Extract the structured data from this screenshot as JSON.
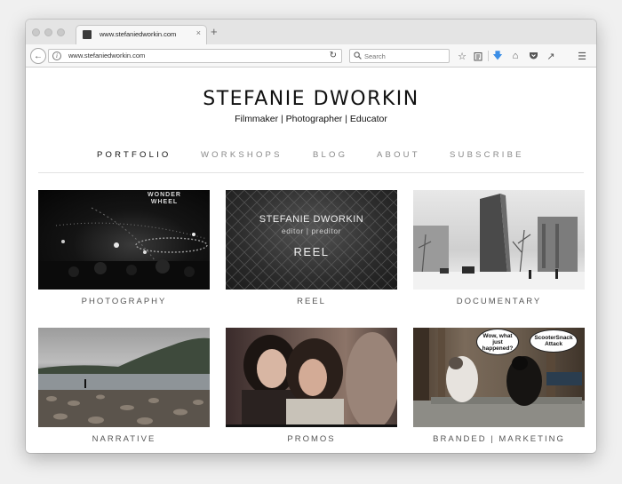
{
  "browser": {
    "tab_title": "www.stefaniedworkin.com",
    "tab_close": "×",
    "new_tab": "+",
    "url": "www.stefaniedworkin.com",
    "search_placeholder": "Search",
    "icons": [
      "back-arrow-icon",
      "info-icon",
      "reload-icon",
      "search-icon",
      "star-icon",
      "reading-list-icon",
      "download-icon",
      "home-icon",
      "pocket-icon",
      "sync-icon",
      "menu-icon"
    ]
  },
  "site": {
    "title": "STEFANIE DWORKIN",
    "tagline": "Filmmaker | Photographer | Educator"
  },
  "nav": [
    {
      "label": "PORTFOLIO",
      "active": true
    },
    {
      "label": "WORKSHOPS",
      "active": false
    },
    {
      "label": "BLOG",
      "active": false
    },
    {
      "label": "ABOUT",
      "active": false
    },
    {
      "label": "SUBSCRIBE",
      "active": false
    }
  ],
  "portfolio": [
    {
      "caption": "PHOTOGRAPHY",
      "sign": "WONDER\nWHEEL"
    },
    {
      "caption": "REEL",
      "overlay_name": "STEFANIE DWORKIN",
      "overlay_sub": "editor | preditor",
      "overlay_label": "REEL"
    },
    {
      "caption": "DOCUMENTARY"
    },
    {
      "caption": "NARRATIVE"
    },
    {
      "caption": "PROMOS"
    },
    {
      "caption": "BRANDED | MARKETING",
      "bubble_left": "Wow, what just happened?",
      "bubble_right": "ScooterSnack Attack"
    }
  ],
  "colors": {
    "accent_text": "#111111",
    "muted_text": "#888888",
    "page_bg": "#ffffff"
  }
}
